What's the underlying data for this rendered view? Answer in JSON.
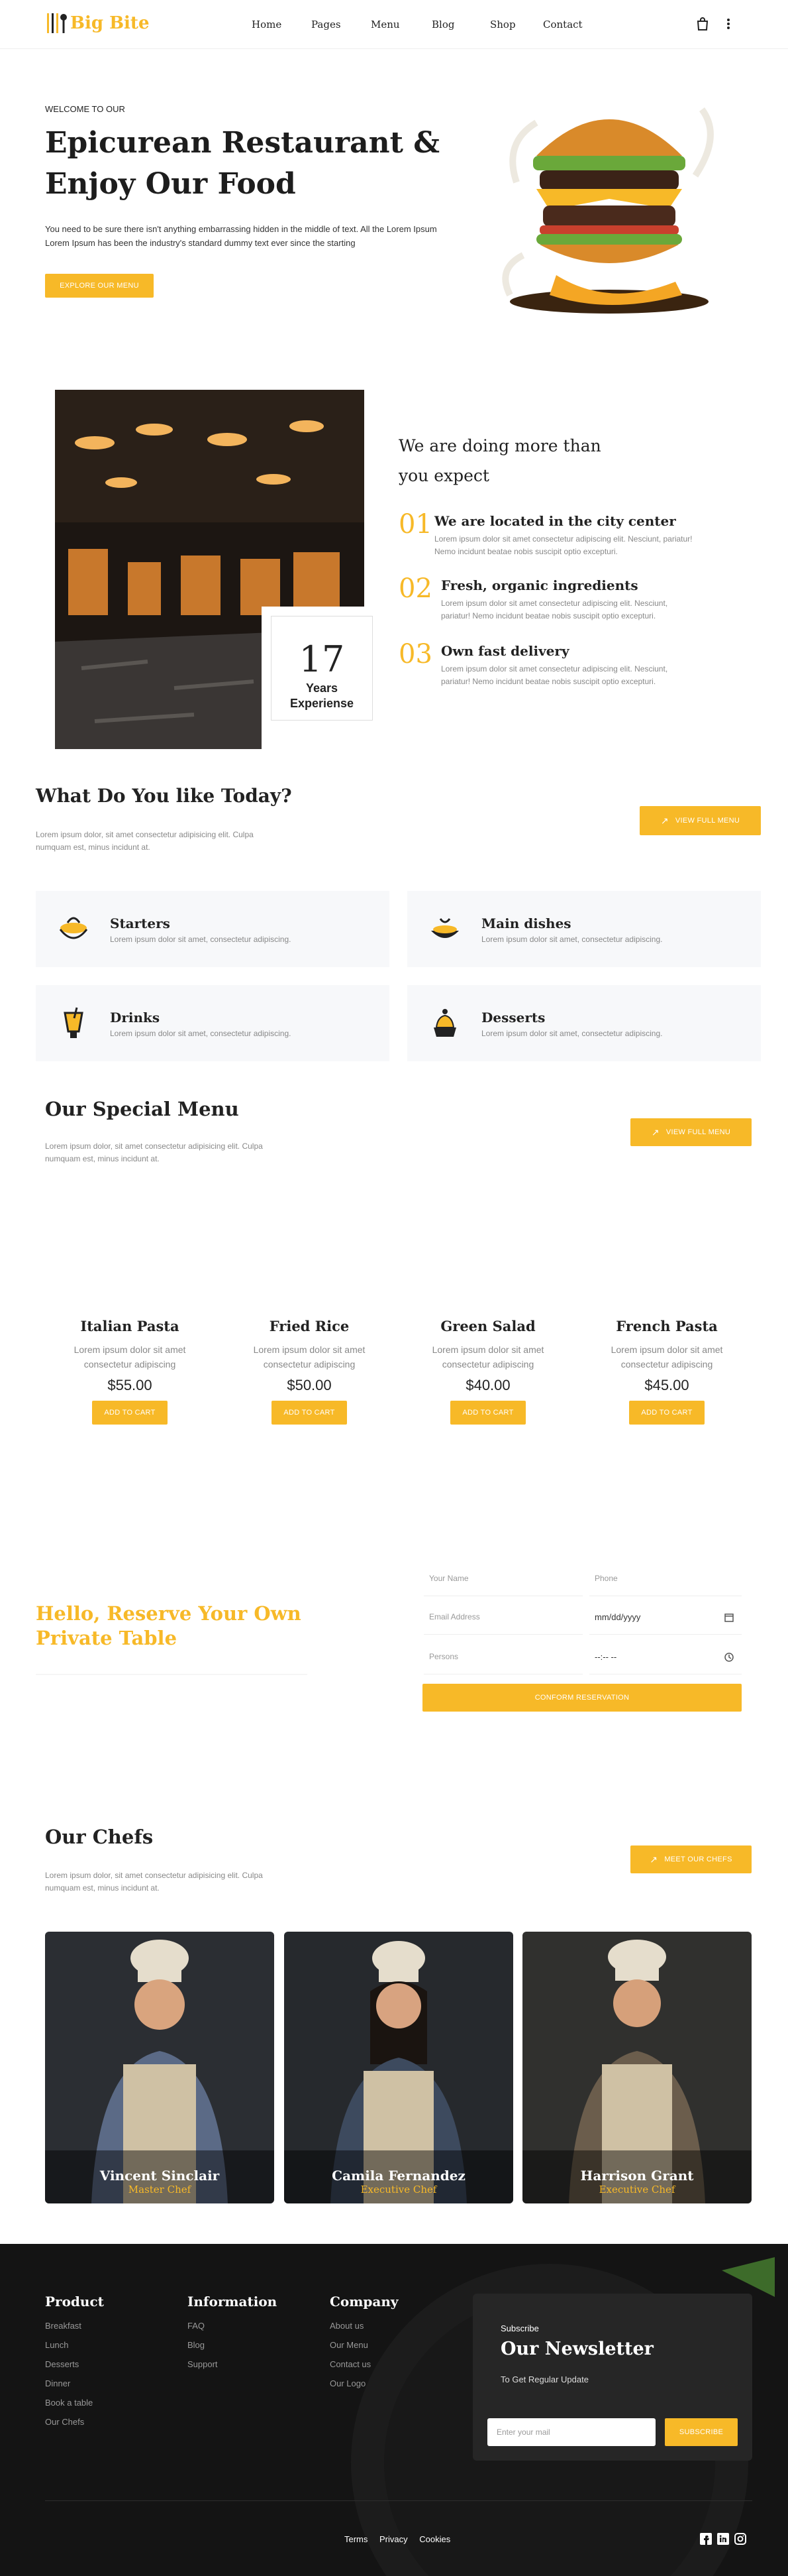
{
  "header": {
    "logo": "Big Bite",
    "nav": [
      "Home",
      "Pages",
      "Menu",
      "Blog",
      "Shop",
      "Contact"
    ]
  },
  "hero": {
    "eyebrow": "WELCOME TO OUR",
    "title_line1": "Epicurean Restaurant &",
    "title_line2": "Enjoy Our Food",
    "text": "You need to be sure there isn't anything embarrassing hidden in the middle of text. All the Lorem Ipsum Lorem Ipsum has been the industry's standard dummy text ever since the starting",
    "button": "EXPLORE OUR MENU"
  },
  "about": {
    "years_number": "17",
    "years_label1": "Years",
    "years_label2": "Experiense",
    "heading_line1": "We are doing more than",
    "heading_line2": "you expect",
    "features": [
      {
        "num": "01",
        "title": "We are located in the city center",
        "text1": "Lorem ipsum dolor sit amet consectetur adipiscing elit. Nesciunt, pariatur!",
        "text2": "Nemo incidunt beatae nobis suscipit optio excepturi."
      },
      {
        "num": "02",
        "title": "Fresh, organic ingredients",
        "text1": "Lorem ipsum dolor sit amet consectetur adipiscing elit. Nesciunt,",
        "text2": "pariatur! Nemo incidunt beatae nobis suscipit optio excepturi."
      },
      {
        "num": "03",
        "title": "Own fast delivery",
        "text1": "Lorem ipsum dolor sit amet consectetur adipiscing elit. Nesciunt,",
        "text2": "pariatur! Nemo incidunt beatae nobis suscipit optio excepturi."
      }
    ]
  },
  "categories": {
    "heading": "What Do You like Today?",
    "text1": "Lorem ipsum dolor, sit amet consectetur adipisicing elit. Culpa",
    "text2": "numquam est, minus incidunt at.",
    "button": "VIEW FULL MENU",
    "items": [
      {
        "title": "Starters",
        "text": "Lorem ipsum dolor sit amet, consectetur adipiscing."
      },
      {
        "title": "Main dishes",
        "text": "Lorem ipsum dolor sit amet, consectetur adipiscing."
      },
      {
        "title": "Drinks",
        "text": "Lorem ipsum dolor sit amet, consectetur adipiscing."
      },
      {
        "title": "Desserts",
        "text": "Lorem ipsum dolor sit amet, consectetur adipiscing."
      }
    ]
  },
  "special": {
    "heading": "Our Special Menu",
    "text1": "Lorem ipsum dolor, sit amet consectetur adipisicing elit. Culpa",
    "text2": "numquam est, minus incidunt at.",
    "button": "VIEW FULL MENU",
    "add_label": "ADD TO CART",
    "items": [
      {
        "name": "Italian Pasta",
        "desc1": "Lorem ipsum dolor sit amet",
        "desc2": "consectetur adipiscing",
        "price": "$55.00"
      },
      {
        "name": "Fried Rice",
        "desc1": "Lorem ipsum dolor sit amet",
        "desc2": "consectetur adipiscing",
        "price": "$50.00"
      },
      {
        "name": "Green Salad",
        "desc1": "Lorem ipsum dolor sit amet",
        "desc2": "consectetur adipiscing",
        "price": "$40.00"
      },
      {
        "name": "French Pasta",
        "desc1": "Lorem ipsum dolor sit amet",
        "desc2": "consectetur adipiscing",
        "price": "$45.00"
      }
    ]
  },
  "reserve": {
    "heading_line1": "Hello, Reserve Your Own",
    "heading_line2": "Private Table",
    "name_placeholder": "Your Name",
    "phone_placeholder": "Phone",
    "email_placeholder": "Email Address",
    "date_value": "mm/dd/yyyy",
    "persons_placeholder": "Persons",
    "time_value": "--:-- --",
    "button": "CONFORM RESERVATION"
  },
  "chefs": {
    "heading": "Our Chefs",
    "text1": "Lorem ipsum dolor, sit amet consectetur adipisicing elit. Culpa",
    "text2": "numquam est, minus incidunt at.",
    "button": "MEET OUR CHEFS",
    "items": [
      {
        "name": "Vincent Sinclair",
        "role": "Master Chef"
      },
      {
        "name": "Camila Fernandez",
        "role": "Executive Chef"
      },
      {
        "name": "Harrison Grant",
        "role": "Executive Chef"
      }
    ]
  },
  "footer": {
    "product": {
      "title": "Product",
      "links": [
        "Breakfast",
        "Lunch",
        "Desserts",
        "Dinner",
        "Book a table",
        "Our Chefs"
      ]
    },
    "information": {
      "title": "Information",
      "links": [
        "FAQ",
        "Blog",
        "Support"
      ]
    },
    "company": {
      "title": "Company",
      "links": [
        "About us",
        "Our Menu",
        "Contact us",
        "Our Logo"
      ]
    },
    "newsletter": {
      "eyebrow": "Subscribe",
      "title": "Our Newsletter",
      "subtitle": "To Get Regular Update",
      "placeholder": "Enter your mail",
      "button": "SUBSCRIBE"
    },
    "bottom": [
      "Terms",
      "Privacy",
      "Cookies"
    ]
  },
  "colors": {
    "accent": "#f7b928",
    "dark": "#141414"
  }
}
